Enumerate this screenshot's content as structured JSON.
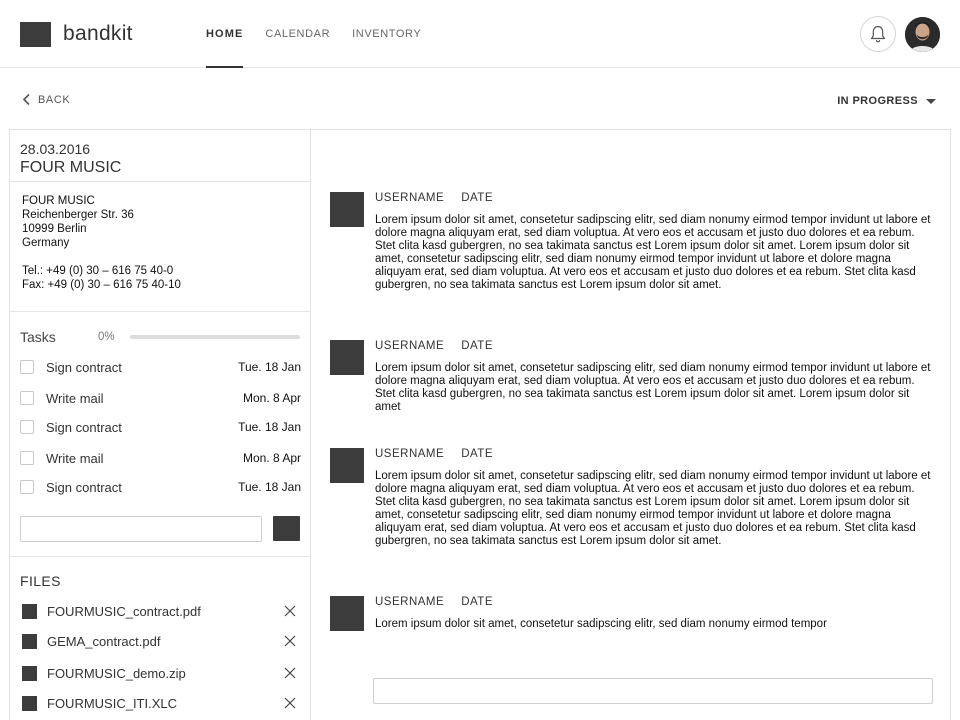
{
  "app": {
    "name": "bandkit"
  },
  "nav": [
    {
      "label": "HOME",
      "active": true
    },
    {
      "label": "CALENDAR",
      "active": false
    },
    {
      "label": "INVENTORY",
      "active": false
    }
  ],
  "icons": {
    "bell": "bell-icon",
    "back": "chevron-left-icon",
    "status": "caret-down-icon",
    "remove": "close-icon"
  },
  "subbar": {
    "back_label": "BACK",
    "status_label": "IN PROGRESS"
  },
  "project": {
    "date": "28.03.2016",
    "name": "FOUR MUSIC",
    "address": [
      "FOUR MUSIC",
      "Reichenberger Str. 36",
      "10999 Berlin",
      "Germany"
    ],
    "tel": "Tel.: +49 (0) 30 – 616 75 40-0",
    "fax": "Fax: +49 (0) 30 – 616 75 40-10"
  },
  "tasks": {
    "title": "Tasks",
    "progress_label": "0%",
    "progress": 0,
    "items": [
      {
        "label": "Sign contract",
        "date": "Tue. 18 Jan"
      },
      {
        "label": "Write mail",
        "date": "Mon. 8 Apr"
      },
      {
        "label": "Sign contract",
        "date": "Tue. 18 Jan"
      },
      {
        "label": "Write mail",
        "date": "Mon. 8 Apr"
      },
      {
        "label": "Sign contract",
        "date": "Tue. 18 Jan"
      }
    ],
    "new_task_value": ""
  },
  "files": {
    "title": "FILES",
    "items": [
      {
        "name": "FOURMUSIC_contract.pdf"
      },
      {
        "name": "GEMA_contract.pdf"
      },
      {
        "name": "FOURMUSIC_demo.zip"
      },
      {
        "name": "FOURMUSIC_ITI.XLC"
      }
    ]
  },
  "comments": [
    {
      "username": "USERNAME",
      "date": "DATE",
      "text": "Lorem ipsum dolor sit amet, consetetur sadipscing elitr, sed diam nonumy eirmod tempor invidunt ut labore et dolore magna aliquyam erat, sed diam voluptua. At vero eos et accusam et justo duo dolores et ea rebum. Stet clita kasd gubergren, no sea takimata sanctus est Lorem ipsum dolor sit amet. Lorem ipsum dolor sit amet, consetetur sadipscing elitr, sed diam nonumy eirmod tempor invidunt ut labore et dolore magna aliquyam erat, sed diam voluptua. At vero eos et accusam et justo duo dolores et ea rebum. Stet clita kasd gubergren, no sea takimata sanctus est Lorem ipsum dolor sit amet."
    },
    {
      "username": "USERNAME",
      "date": "DATE",
      "text": "Lorem ipsum dolor sit amet, consetetur sadipscing elitr, sed diam nonumy eirmod tempor invidunt ut labore et dolore magna aliquyam erat, sed diam voluptua. At vero eos et accusam et justo duo dolores et ea rebum. Stet clita kasd gubergren, no sea takimata sanctus est Lorem ipsum dolor sit amet. Lorem ipsum dolor sit amet"
    },
    {
      "username": "USERNAME",
      "date": "DATE",
      "text": "Lorem ipsum dolor sit amet, consetetur sadipscing elitr, sed diam nonumy eirmod tempor invidunt ut labore et dolore magna aliquyam erat, sed diam voluptua. At vero eos et accusam et justo duo dolores et ea rebum. Stet clita kasd gubergren, no sea takimata sanctus est Lorem ipsum dolor sit amet. Lorem ipsum dolor sit amet, consetetur sadipscing elitr, sed diam nonumy eirmod tempor invidunt ut labore et dolore magna aliquyam erat, sed diam voluptua. At vero eos et accusam et justo duo dolores et ea rebum. Stet clita kasd gubergren, no sea takimata sanctus est Lorem ipsum dolor sit amet."
    },
    {
      "username": "USERNAME",
      "date": "DATE",
      "text": "Lorem ipsum dolor sit amet, consetetur sadipscing elitr, sed diam nonumy eirmod tempor"
    }
  ],
  "reply": {
    "value": ""
  }
}
